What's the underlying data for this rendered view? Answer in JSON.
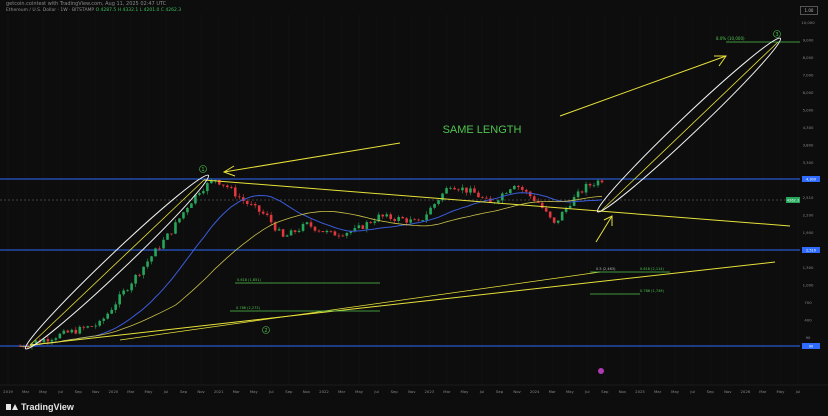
{
  "header": {
    "published": "getcoin.cointest with TradingView.com, Aug 11, 2025 02:47 UTC",
    "legend_symbol": "Ethereum / U.S. Dollar · 1W · BITSTAMP",
    "legend_values": "O 4287.5  H 4332.1  L 4201.0  C 4262.3",
    "axis_top_box": "1.00"
  },
  "annotations": {
    "headline": "SAME LENGTH",
    "target_label": "8.0% (10,000)",
    "wave_1": "1",
    "wave_2": "2",
    "wave_3": "3",
    "fib_1": "0.618 (1,851)",
    "fib_2": "0.786 (2,273)",
    "fib_3": "0.5 (2,463)",
    "fib_4": "0.618 (2,114)",
    "fib_5": "0.786 (1,749)",
    "price_tag": "4262.3",
    "level_tag_1": "4,300",
    "level_tag_2": "2,510",
    "level_tag_3": "90"
  },
  "colors": {
    "background": "#0d0d0d",
    "up": "#26a65b",
    "down": "#e0383e",
    "trend": "#e8e23a",
    "ellipse": "#f2f2f2",
    "horizontal": "#2f6bff",
    "ma": "#3a5bd9",
    "annotation_green": "#4fc44f"
  },
  "chart_data": {
    "type": "candlestick",
    "xlabels": [
      "2019",
      "Mar",
      "May",
      "Jul",
      "Sep",
      "Nov",
      "2020",
      "Mar",
      "May",
      "Jul",
      "Sep",
      "Nov",
      "2021",
      "Mar",
      "May",
      "Jul",
      "Sep",
      "Nov",
      "2022",
      "Mar",
      "May",
      "Jul",
      "Sep",
      "Nov",
      "2023",
      "Mar",
      "May",
      "Jul",
      "Sep",
      "Nov",
      "2024",
      "Mar",
      "May",
      "Jul",
      "Sep",
      "Nov",
      "2025",
      "Mar",
      "May",
      "Jul",
      "Sep",
      "Nov",
      "2026",
      "Mar",
      "May",
      "Jul"
    ],
    "ylabels": [
      "10,000",
      "9,000",
      "8,000",
      "7,000",
      "6,000",
      "5,000",
      "4,300",
      "3,800",
      "3,300",
      "2,900",
      "2,510",
      "2,200",
      "1,900",
      "1,600",
      "1,300",
      "1,000",
      "700",
      "400",
      "90"
    ],
    "anchors": [
      {
        "t": 0,
        "p": 90
      },
      {
        "t": 20,
        "p": 150
      },
      {
        "t": 28,
        "p": 400
      },
      {
        "t": 38,
        "p": 1300
      },
      {
        "t": 42,
        "p": 2300
      },
      {
        "t": 45,
        "p": 3300
      },
      {
        "t": 49,
        "p": 4300
      },
      {
        "t": 52,
        "p": 3600
      },
      {
        "t": 56,
        "p": 2600
      },
      {
        "t": 62,
        "p": 1800
      },
      {
        "t": 66,
        "p": 1100
      },
      {
        "t": 72,
        "p": 1500
      },
      {
        "t": 78,
        "p": 1200
      },
      {
        "t": 84,
        "p": 1300
      },
      {
        "t": 90,
        "p": 1800
      },
      {
        "t": 96,
        "p": 1700
      },
      {
        "t": 100,
        "p": 1550
      },
      {
        "t": 108,
        "p": 3800
      },
      {
        "t": 114,
        "p": 3100
      },
      {
        "t": 118,
        "p": 2400
      },
      {
        "t": 124,
        "p": 3900
      },
      {
        "t": 130,
        "p": 2500
      },
      {
        "t": 134,
        "p": 1500
      },
      {
        "t": 138,
        "p": 2500
      },
      {
        "t": 142,
        "p": 3600
      },
      {
        "t": 146,
        "p": 4262
      }
    ],
    "total_weeks": 146
  }
}
